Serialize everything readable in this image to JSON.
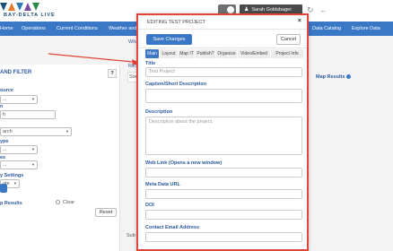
{
  "header": {
    "logo_text": "BAY-DELTA LIVE",
    "user_name": "Sarah Goldsbager"
  },
  "nav": {
    "items": [
      "Home",
      "Operations",
      "Current Conditions",
      "Weather and",
      "Data Catalog",
      "Explore Data"
    ]
  },
  "sidebar": {
    "title": "AND FILTER",
    "help_label": "?",
    "labels": [
      "ource",
      "n",
      "ype",
      "es",
      "y Settings"
    ],
    "selects": [
      "...",
      "...",
      "...",
      "ate"
    ],
    "search_text": "h",
    "search_dropdown": "arch",
    "results_label": "p Results",
    "clear_label": "Clear",
    "reset_label": "Reset"
  },
  "background": {
    "tab_fragment_1": "What",
    "tab_fragment_2": "RESU",
    "sort_fragment": "Sort",
    "map_results": "Map Results",
    "sub_fragment": "Sub"
  },
  "modal": {
    "title": "EDITING TEST PROJECT",
    "close_label": "×",
    "save_label": "Save Changes",
    "cancel_label": "Cancel",
    "tabs": [
      "Main",
      "Layout",
      "Map IT",
      "Publish?",
      "Organize",
      "Video/Embed",
      "Project Info"
    ],
    "active_tab": "Main",
    "fields": {
      "title_label": "Title",
      "title_value": "Test Project",
      "caption_label": "Caption/Short Description",
      "description_label": "Description",
      "description_placeholder": "Description about the project.",
      "weblink_label": "Web Link (Opens a new window)",
      "metadata_label": "Meta Data URL",
      "doi_label": "DOI",
      "contact_label": "Contact Email Address"
    }
  },
  "colors": {
    "nav_blue": "#3a77c4",
    "modal_border": "#e0453a",
    "arrow_red": "#e0453a",
    "label_blue": "#2d5aa0"
  },
  "icons": [
    "user-icon",
    "reload-icon",
    "back-arrow-icon",
    "close-icon",
    "help-icon",
    "radio-icon",
    "chevron-down-icon"
  ]
}
